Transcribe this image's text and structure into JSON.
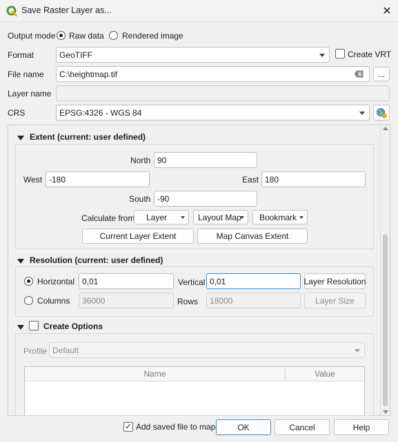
{
  "window": {
    "title": "Save Raster Layer as...",
    "close_glyph": "✕"
  },
  "output_mode": {
    "label": "Output mode",
    "options": [
      "Raw data",
      "Rendered image"
    ],
    "selected": "Raw data"
  },
  "format": {
    "label": "Format",
    "value": "GeoTIFF",
    "create_vrt_label": "Create VRT",
    "create_vrt_checked": false
  },
  "file_name": {
    "label": "File name",
    "value": "C:\\heightmap.tif",
    "browse_label": "..."
  },
  "layer_name": {
    "label": "Layer name",
    "value": ""
  },
  "crs": {
    "label": "CRS",
    "value": "EPSG:4326 - WGS 84"
  },
  "extent": {
    "title": "Extent (current: user defined)",
    "north_label": "North",
    "north": "90",
    "west_label": "West",
    "west": "-180",
    "east_label": "East",
    "east": "180",
    "south_label": "South",
    "south": "-90",
    "calculate_from_label": "Calculate from",
    "calc_buttons": [
      "Layer",
      "Layout Map",
      "Bookmark"
    ],
    "current_layer_extent": "Current Layer Extent",
    "map_canvas_extent": "Map Canvas Extent"
  },
  "resolution": {
    "title": "Resolution (current: user defined)",
    "horizontal_label": "Horizontal",
    "horizontal": "0,01",
    "vertical_label": "Vertical",
    "vertical": "0,01",
    "layer_resolution": "Layer Resolution",
    "columns_label": "Columns",
    "columns": "36000",
    "rows_label": "Rows",
    "rows": "18000",
    "layer_size": "Layer Size",
    "selected": "Horizontal"
  },
  "create_options": {
    "title": "Create Options",
    "checked": false,
    "profile_label": "Profile",
    "profile": "Default",
    "columns": [
      "Name",
      "Value"
    ]
  },
  "footer": {
    "add_saved_file_label": "Add saved file to map",
    "add_saved_file_checked": true,
    "ok": "OK",
    "cancel": "Cancel",
    "help": "Help"
  },
  "colors": {
    "accent": "#3d8ed8",
    "qgis_green": "#589632",
    "qgis_yellow": "#f0b400"
  }
}
